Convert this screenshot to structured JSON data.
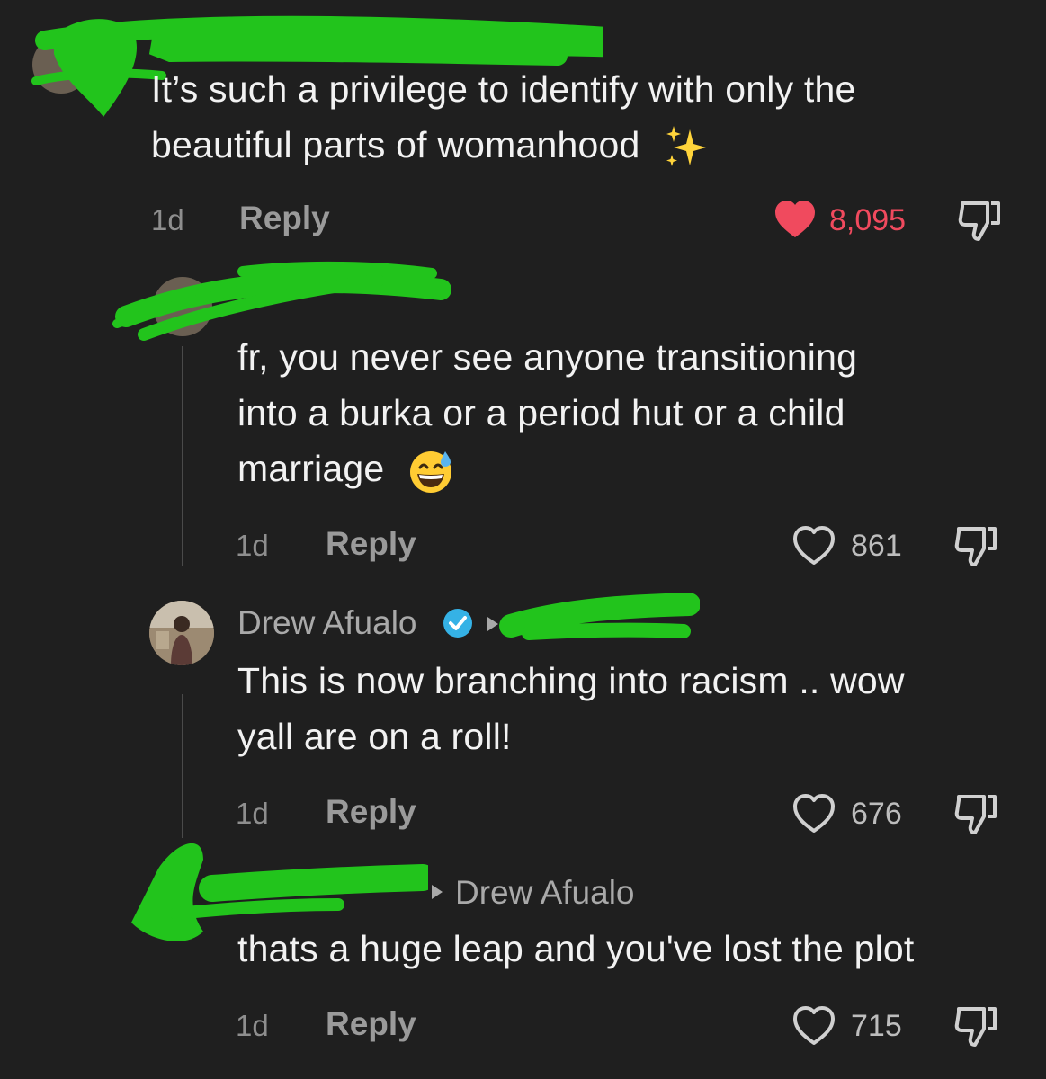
{
  "comments": [
    {
      "text_line1": "It’s such a privilege to identify with only the",
      "text_line2": "beautiful parts of womanhood",
      "time": "1d",
      "reply_label": "Reply",
      "likes": "8,095",
      "liked": true
    },
    {
      "text_line1": "fr, you never see anyone transitioning",
      "text_line2": "into a burka or a period hut or a child",
      "text_line3": "marriage",
      "time": "1d",
      "reply_label": "Reply",
      "likes": "861",
      "liked": false
    },
    {
      "username": "Drew Afualo",
      "text_line1": "This is now branching into racism .. wow",
      "text_line2": "yall are on a roll!",
      "time": "1d",
      "reply_label": "Reply",
      "likes": "676",
      "liked": false
    },
    {
      "reply_to": "Drew Afualo",
      "text_line1": "thats a huge leap and you've lost the plot",
      "time": "1d",
      "reply_label": "Reply",
      "likes": "715",
      "liked": false
    }
  ],
  "colors": {
    "background": "#1f1f1f",
    "liked_heart": "#f04a5e",
    "verified_badge": "#35b2e6",
    "redaction_green": "#22c41c"
  },
  "icons": [
    "sparkles-icon",
    "heart-icon",
    "dislike-icon",
    "verified-badge-icon",
    "reply-arrow-icon",
    "grinning-sweat-emoji"
  ]
}
